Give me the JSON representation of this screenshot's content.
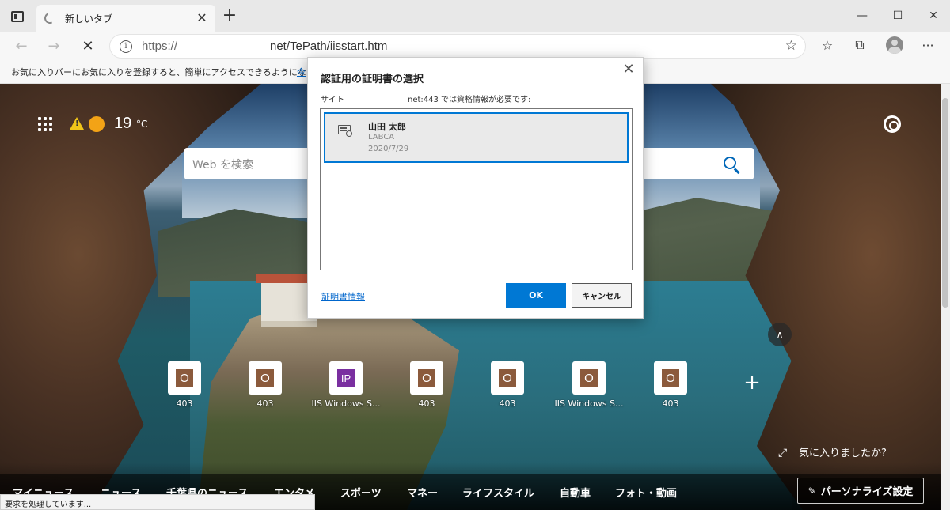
{
  "tab": {
    "title": "新しいタブ",
    "close": "✕"
  },
  "new_tab": "+",
  "window": {
    "minimize": "—",
    "maximize": "☐",
    "close": "✕"
  },
  "nav": {
    "back": "←",
    "forward": "→",
    "stop": "✕"
  },
  "address": {
    "scheme": "https://",
    "path": "net/TePath/iisstart.htm",
    "info": "i"
  },
  "favorites_bar": {
    "message": "お気に入りバーにお気に入りを登録すると、簡単にアクセスできるようになります。",
    "link": "今"
  },
  "toolbar_icons": {
    "favorites": "☆",
    "collections": "⧉",
    "more": "···",
    "add_favorite": "☆"
  },
  "weather": {
    "temp": "19",
    "unit": "°C"
  },
  "search": {
    "placeholder": "Web を検索"
  },
  "tiles": [
    {
      "letter": "O",
      "label": "403",
      "color": "brown"
    },
    {
      "letter": "O",
      "label": "403",
      "color": "brown"
    },
    {
      "letter": "IP",
      "label": "IIS Windows S...",
      "color": "purple"
    },
    {
      "letter": "O",
      "label": "403",
      "color": "brown"
    },
    {
      "letter": "O",
      "label": "403",
      "color": "brown"
    },
    {
      "letter": "O",
      "label": "IIS Windows S...",
      "color": "brown"
    },
    {
      "letter": "O",
      "label": "403",
      "color": "brown"
    }
  ],
  "add_tile": "+",
  "chevron_up": "∧",
  "like_prompt": "気に入りましたか?",
  "news_nav": [
    "マイニュース",
    "ニュース",
    "千葉県のニュース",
    "エンタメ",
    "スポーツ",
    "マネー",
    "ライフスタイル",
    "自動車",
    "フォト・動画"
  ],
  "personalize": "パーソナライズ設定",
  "status": "要求を処理しています...",
  "dialog": {
    "title": "認証用の証明書の選択",
    "close": "✕",
    "site_label": "サイト",
    "site_info": "net:443 では資格情報が必要です:",
    "certificates": [
      {
        "name": "山田 太郎",
        "issuer": "LABCA",
        "date": "2020/7/29"
      }
    ],
    "cert_info_link": "証明書情報",
    "ok": "OK",
    "cancel": "キャンセル"
  },
  "colors": {
    "accent": "#0078d4",
    "link": "#0066cc",
    "tile_brown": "#8b5a3c",
    "tile_purple": "#7a2fa0"
  }
}
